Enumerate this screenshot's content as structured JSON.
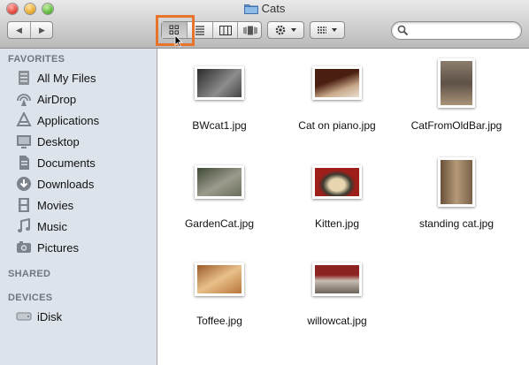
{
  "window": {
    "title": "Cats"
  },
  "toolbar": {
    "back": "◀",
    "forward": "▶",
    "view_buttons": [
      "icon-view",
      "list-view",
      "column-view",
      "cover-flow-view"
    ],
    "active_view": "icon-view",
    "search_placeholder": ""
  },
  "sidebar": {
    "favorites_header": "FAVORITES",
    "favorites": [
      {
        "label": "All My Files",
        "icon": "all-files-icon"
      },
      {
        "label": "AirDrop",
        "icon": "airdrop-icon"
      },
      {
        "label": "Applications",
        "icon": "applications-icon"
      },
      {
        "label": "Desktop",
        "icon": "desktop-icon"
      },
      {
        "label": "Documents",
        "icon": "documents-icon"
      },
      {
        "label": "Downloads",
        "icon": "downloads-icon"
      },
      {
        "label": "Movies",
        "icon": "movies-icon"
      },
      {
        "label": "Music",
        "icon": "music-icon"
      },
      {
        "label": "Pictures",
        "icon": "pictures-icon"
      }
    ],
    "shared_header": "SHARED",
    "devices_header": "DEVICES",
    "devices": [
      {
        "label": "iDisk",
        "icon": "disk-icon"
      }
    ]
  },
  "files": [
    {
      "name": "BWcat1.jpg",
      "colors": [
        "#3a3a3a",
        "#9a9a9a"
      ]
    },
    {
      "name": "Cat on piano.jpg",
      "colors": [
        "#5a2a18",
        "#d9c5b0"
      ]
    },
    {
      "name": "CatFromOldBar.jpg",
      "colors": [
        "#6b5e52",
        "#b9a890"
      ]
    },
    {
      "name": "GardenCat.jpg",
      "colors": [
        "#4f5a45",
        "#a8a79a"
      ]
    },
    {
      "name": "Kitten.jpg",
      "colors": [
        "#9e1e1a",
        "#e8d6b0"
      ]
    },
    {
      "name": "standing cat.jpg",
      "colors": [
        "#8a6a48",
        "#c9b493"
      ]
    },
    {
      "name": "Toffee.jpg",
      "colors": [
        "#b8753a",
        "#e9c08a"
      ]
    },
    {
      "name": "willowcat.jpg",
      "colors": [
        "#8d2320",
        "#d8d0c8"
      ]
    }
  ]
}
